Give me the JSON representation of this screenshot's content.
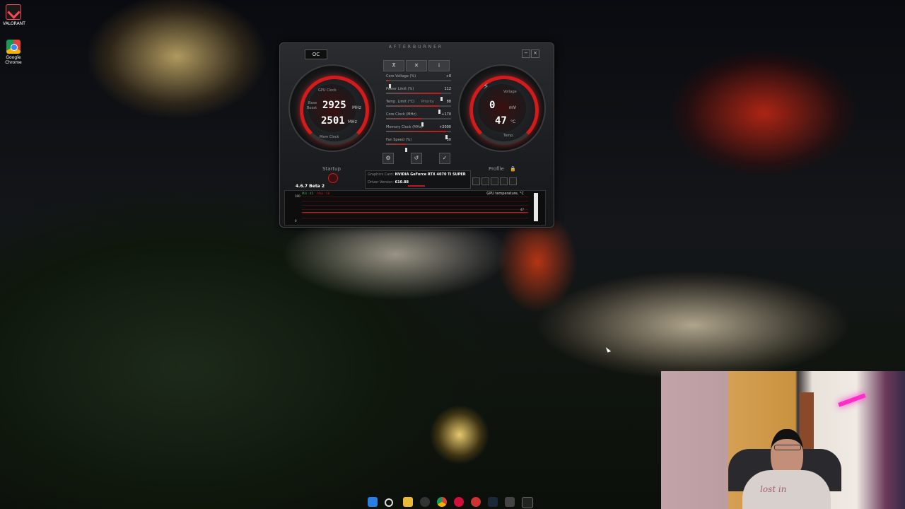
{
  "desktop": {
    "icons": [
      {
        "label": "VALORANT",
        "icon": "valorant-icon"
      },
      {
        "label": "Google Chrome",
        "icon": "chrome-icon"
      }
    ]
  },
  "afterburner": {
    "title": "AFTERBURNER",
    "oc_button": "OC",
    "left_gauge": {
      "top_label": "GPU Clock",
      "base_label": "Base",
      "boost_label": "Boost",
      "primary_value": "2925",
      "primary_unit": "MHz",
      "secondary_value": "2501",
      "secondary_unit": "MHz",
      "bottom_label": "Mem Clock"
    },
    "right_gauge": {
      "top_label": "Voltage",
      "primary_value": "0",
      "primary_unit": "mV",
      "secondary_value": "47",
      "secondary_unit": "°C",
      "bottom_label": "Temp."
    },
    "controls": [
      {
        "label": "Core Voltage (%)",
        "value": "+0",
        "fill": 0.05
      },
      {
        "label": "Power Limit (%)",
        "value": "112",
        "fill": 0.85
      },
      {
        "label": "Temp. Limit (°C)",
        "value": "88",
        "fill": 0.82
      },
      {
        "label": "Core Clock (MHz)",
        "value": "+170",
        "fill": 0.55
      },
      {
        "label": "Memory Clock (MHz)",
        "value": "+2000",
        "fill": 0.92
      },
      {
        "label": "Fan Speed (%)",
        "value": "30",
        "fill": 0.3
      }
    ],
    "priority_label": "Priority",
    "startup_label": "Startup",
    "profile_label": "Profile",
    "graphics_card_label": "Graphics Card:",
    "graphics_card_value": "NVIDIA GeForce RTX 4070 Ti SUPER",
    "driver_label": "Driver Version:",
    "driver_value": "610.88",
    "version": "4.6.7 Beta 2",
    "graph": {
      "min_label": "Min : 45",
      "max_label": "Max : 58",
      "title": "GPU temperature, °C",
      "y_top": "100",
      "y_bottom": "0",
      "current": "47"
    }
  },
  "webcam": {
    "shirt_text": "lost in"
  },
  "taskbar": {
    "icons": [
      "windows-start-icon",
      "search-icon",
      "file-explorer-icon",
      "obs-icon",
      "chrome-icon",
      "record-icon",
      "app-icon",
      "steam-icon",
      "afterburner-icon",
      "terminal-icon"
    ]
  },
  "colors": {
    "accent_red": "#d41a1a",
    "panel_dark": "#1d1f22"
  }
}
